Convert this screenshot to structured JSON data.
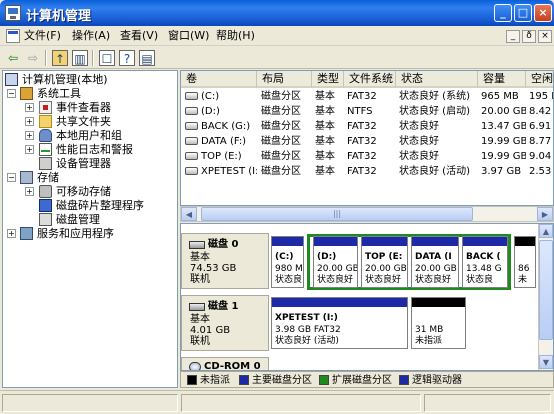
{
  "window": {
    "title": "计算机管理",
    "controls": {
      "minimize": "_",
      "maximize": "□",
      "close": "×"
    }
  },
  "menu": {
    "items": [
      "文件(F)",
      "操作(A)",
      "查看(V)",
      "窗口(W)",
      "帮助(H)"
    ],
    "mdi_controls": [
      "_",
      "ð",
      "×"
    ]
  },
  "toolbar": {
    "icons": [
      "back-arrow",
      "forward-arrow",
      "up-folder",
      "show-tree",
      "properties",
      "help",
      "refresh-list"
    ]
  },
  "tree": {
    "items": [
      {
        "label": "计算机管理(本地)",
        "level": 0,
        "expander": "",
        "icon": "computer-icon"
      },
      {
        "label": "系统工具",
        "level": 1,
        "expander": "−",
        "icon": "tools-icon"
      },
      {
        "label": "事件查看器",
        "level": 2,
        "expander": "+",
        "icon": "event-viewer-icon"
      },
      {
        "label": "共享文件夹",
        "level": 2,
        "expander": "+",
        "icon": "shared-folder-icon"
      },
      {
        "label": "本地用户和组",
        "level": 2,
        "expander": "+",
        "icon": "users-icon"
      },
      {
        "label": "性能日志和警报",
        "level": 2,
        "expander": "+",
        "icon": "performance-icon"
      },
      {
        "label": "设备管理器",
        "level": 2,
        "expander": "",
        "icon": "device-manager-icon"
      },
      {
        "label": "存储",
        "level": 1,
        "expander": "−",
        "icon": "storage-icon"
      },
      {
        "label": "可移动存储",
        "level": 2,
        "expander": "+",
        "icon": "removable-storage-icon"
      },
      {
        "label": "磁盘碎片整理程序",
        "level": 2,
        "expander": "",
        "icon": "defrag-icon"
      },
      {
        "label": "磁盘管理",
        "level": 2,
        "expander": "",
        "icon": "disk-management-icon"
      },
      {
        "label": "服务和应用程序",
        "level": 1,
        "expander": "+",
        "icon": "services-icon"
      }
    ]
  },
  "volumes": {
    "headers": [
      "卷",
      "布局",
      "类型",
      "文件系统",
      "状态",
      "容量",
      "空闲"
    ],
    "rows": [
      [
        "(C:)",
        "磁盘分区",
        "基本",
        "FAT32",
        "状态良好 (系统)",
        "965 MB",
        "195 M"
      ],
      [
        "(D:)",
        "磁盘分区",
        "基本",
        "NTFS",
        "状态良好 (启动)",
        "20.00 GB",
        "8.42"
      ],
      [
        "BACK (G:)",
        "磁盘分区",
        "基本",
        "FAT32",
        "状态良好",
        "13.47 GB",
        "6.91"
      ],
      [
        "DATA (F:)",
        "磁盘分区",
        "基本",
        "FAT32",
        "状态良好",
        "19.99 GB",
        "8.77"
      ],
      [
        "TOP (E:)",
        "磁盘分区",
        "基本",
        "FAT32",
        "状态良好",
        "19.99 GB",
        "9.04"
      ],
      [
        "XPETEST (I:)",
        "磁盘分区",
        "基本",
        "FAT32",
        "状态良好 (活动)",
        "3.97 GB",
        "2.53"
      ]
    ],
    "scroll_grip": "|||"
  },
  "disks": [
    {
      "name": "磁盘 0",
      "type": "基本",
      "size": "74.53 GB",
      "status": "联机"
    },
    {
      "name": "磁盘 1",
      "type": "基本",
      "size": "4.01 GB",
      "status": "联机"
    },
    {
      "name": "CD-ROM 0"
    }
  ],
  "partitions": {
    "disk0": [
      {
        "name": "(C:)",
        "size": "980 M",
        "status": "状态良"
      },
      {
        "name": "(D:)",
        "size": "20.00 GB",
        "status": "状态良好"
      },
      {
        "name": "TOP (E:",
        "size": "20.00 GB",
        "status": "状态良好"
      },
      {
        "name": "DATA (I",
        "size": "20.00 GB",
        "status": "状态良好"
      },
      {
        "name": "BACK (",
        "size": "13.48 G",
        "status": "状态良"
      },
      {
        "name": "",
        "size": "86",
        "status": "未"
      }
    ],
    "disk1": [
      {
        "name": "XPETEST (I:)",
        "size": "3.98 GB FAT32",
        "status": "状态良好 (活动)"
      },
      {
        "name": "",
        "size": "31 MB",
        "status": "未指派"
      }
    ]
  },
  "legend": [
    {
      "label": "未指派",
      "color": "#000000"
    },
    {
      "label": "主要磁盘分区",
      "color": "#1c2aa8"
    },
    {
      "label": "扩展磁盘分区",
      "color": "#1f8a1f"
    },
    {
      "label": "逻辑驱动器",
      "color": "#1c2aa8"
    }
  ],
  "colors": {
    "primary": "#1c2aa8",
    "extended": "#1f8a1f",
    "unallocated": "#000000",
    "titlebar": "#0a5fd8"
  }
}
